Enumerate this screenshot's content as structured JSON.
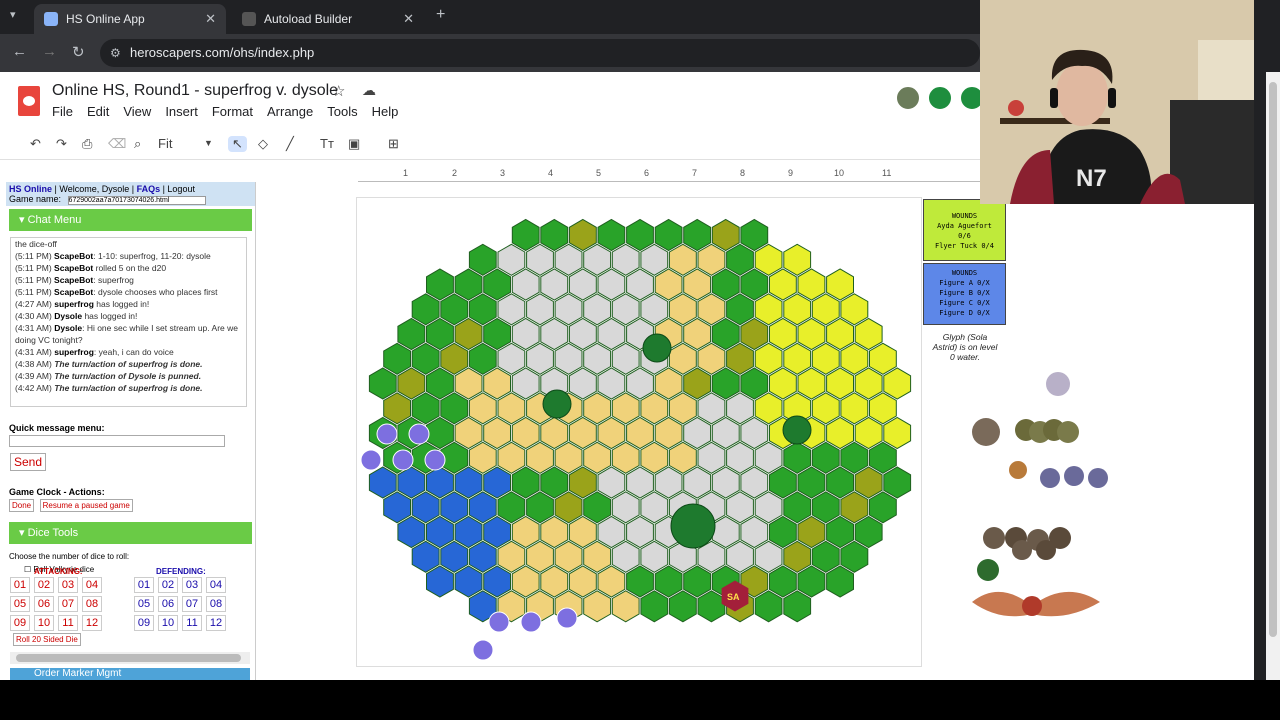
{
  "browser": {
    "tabs": [
      {
        "label": "HS Online App",
        "active": true
      },
      {
        "label": "Autoload Builder",
        "active": false
      }
    ],
    "new_tab": "+",
    "url": "heroscapers.com/ohs/index.php"
  },
  "doc": {
    "title": "Online HS, Round1 - superfrog v. dysole",
    "menus": [
      "File",
      "Edit",
      "View",
      "Insert",
      "Format",
      "Arrange",
      "Tools",
      "Help"
    ],
    "zoom": "Fit"
  },
  "ruler": [
    "1",
    "2",
    "3",
    "4",
    "5",
    "6",
    "7",
    "8",
    "9",
    "10",
    "11"
  ],
  "panel": {
    "site": "HS Online",
    "welcome": "Welcome, Dysole",
    "faqs": "FAQs",
    "logout": "Logout",
    "game_name_label": "Game name:",
    "game_name_value": "6729002aa7a70173074026.html",
    "chat_menu": "Chat Menu",
    "chat": [
      {
        "time": "",
        "who": "",
        "msg": "the dice-off"
      },
      {
        "time": "(5:11 PM)",
        "who": "ScapeBot",
        "msg": ": 1-10: superfrog, 11-20: dysole"
      },
      {
        "time": "(5:11 PM)",
        "who": "ScapeBot",
        "msg": " rolled 5 on the d20"
      },
      {
        "time": "(5:11 PM)",
        "who": "ScapeBot",
        "msg": ": superfrog"
      },
      {
        "time": "(5:11 PM)",
        "who": "ScapeBot",
        "msg": ": dysole chooses who places first"
      },
      {
        "time": "(4:27 AM)",
        "who": "superfrog",
        "msg": " has logged in!"
      },
      {
        "time": "(4:30 AM)",
        "who": "Dysole",
        "msg": " has logged in!"
      },
      {
        "time": "(4:31 AM)",
        "who": "Dysole",
        "msg": ": Hi one sec while I set stream up. Are we doing VC tonight?"
      },
      {
        "time": "(4:31 AM)",
        "who": "superfrog",
        "msg": ": yeah, i can do voice"
      },
      {
        "time": "(4:38 AM)",
        "who": "",
        "msg": "The turn/action of superfrog is done."
      },
      {
        "time": "(4:39 AM)",
        "who": "",
        "msg": "The turn/action of Dysole is punned."
      },
      {
        "time": "(4:42 AM)",
        "who": "",
        "msg": "The turn/action of superfrog is done."
      }
    ],
    "quick_message": "Quick message menu:",
    "send": "Send",
    "game_clock": "Game Clock - Actions:",
    "done": "Done",
    "resume": "Resume a paused game",
    "dice_tools": "Dice Tools",
    "choose": "Choose the number of dice to roll:",
    "valkyrie": "Roll Valkyrie dice",
    "attacking": "ATTACKING:",
    "defending": "DEFENDING:",
    "dice": [
      "01",
      "02",
      "03",
      "04",
      "05",
      "06",
      "07",
      "08",
      "09",
      "10",
      "11",
      "12"
    ],
    "roll20": "Roll 20 Sided Die",
    "order_marker": "Order Marker Mgmt"
  },
  "wounds_yellow": {
    "title": "WOUNDS",
    "line1": "Ayda Aguefort",
    "line2": "0/6",
    "line3": "Flyer Tuck  0/4"
  },
  "wounds_blue": {
    "title": "WOUNDS",
    "lines": [
      "Figure A  0/X",
      "Figure B  0/X",
      "Figure C  0/X",
      "Figure D  0/X"
    ]
  },
  "glyph_note": "Glyph (Sola Astrid) is on level 0 water.",
  "board": {
    "start_zone_label": "SA",
    "colors": {
      "grass": "#29a329",
      "sand": "#f0d27a",
      "rock": "#b89a78",
      "road": "#d8d8d8",
      "water": "#2767d6",
      "olive": "#9aa31a",
      "yellow": "#e8ef2a",
      "start_purple": "#7d6fe0",
      "start_red": "#a31f3a"
    }
  }
}
